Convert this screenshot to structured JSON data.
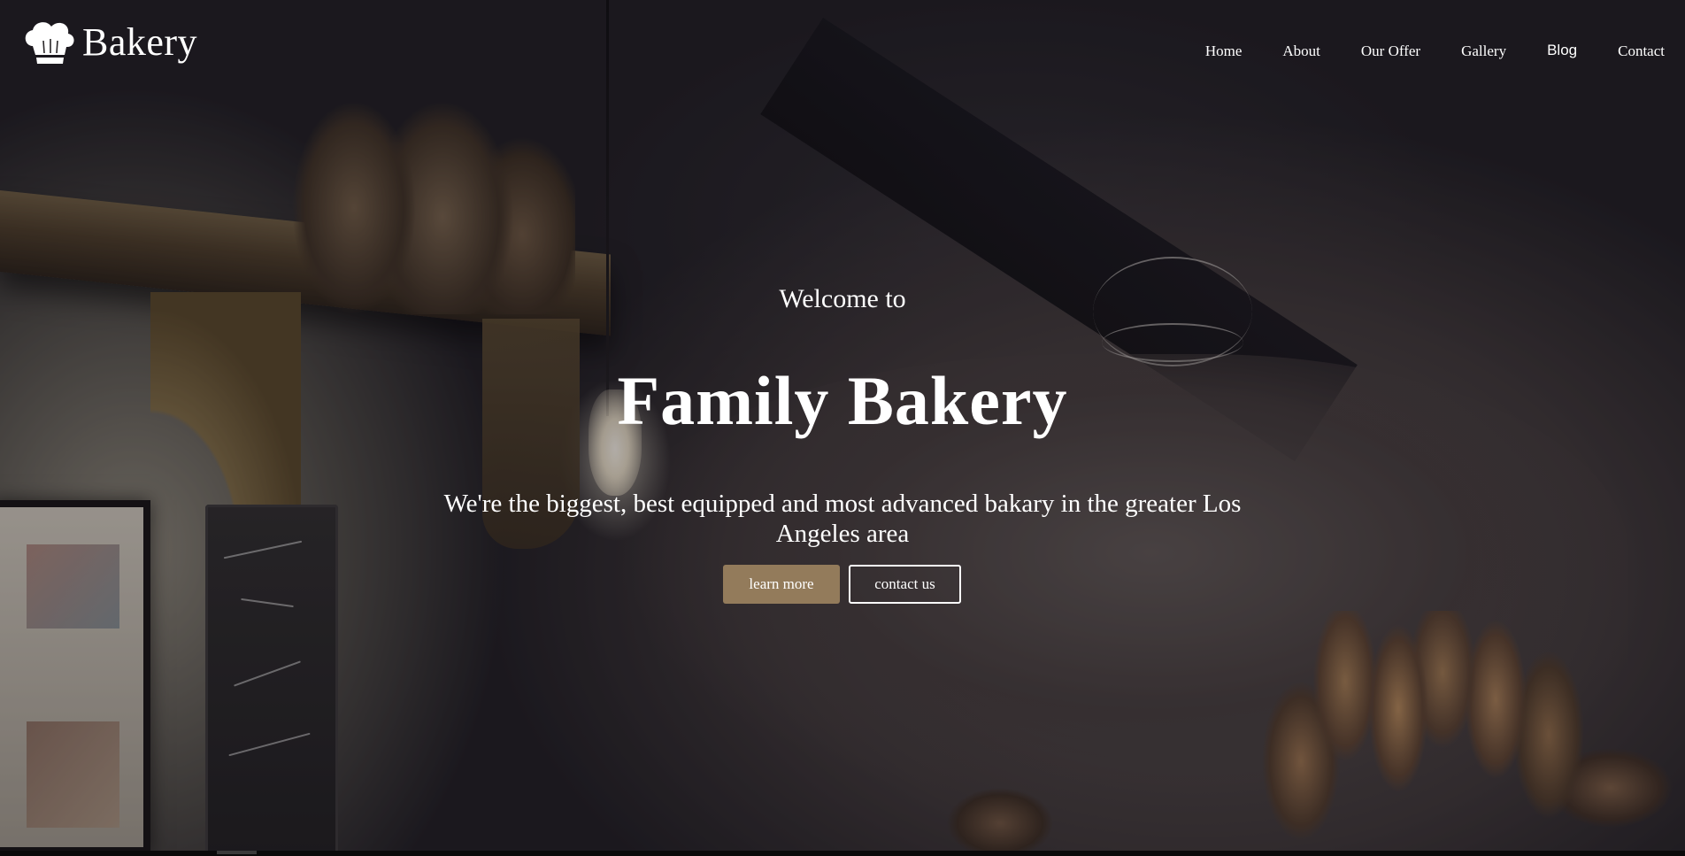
{
  "brand": {
    "name": "Bakery",
    "icon": "chef-hat-icon"
  },
  "nav": {
    "items": [
      {
        "label": "Home"
      },
      {
        "label": "About"
      },
      {
        "label": "Our Offer"
      },
      {
        "label": "Gallery"
      },
      {
        "label": "Blog"
      },
      {
        "label": "Contact"
      }
    ]
  },
  "hero": {
    "welcome": "Welcome to",
    "title": "Family Bakery",
    "tagline": "We're the biggest, best equipped and most advanced bakary in the greater Los Angeles area",
    "primary_button": "learn more",
    "secondary_button": "contact us",
    "background": "bakery interior photo with bread baskets, shelf and chalkboard"
  },
  "colors": {
    "accent": "#937b5b",
    "text": "#ffffff",
    "overlay": "#121014"
  }
}
